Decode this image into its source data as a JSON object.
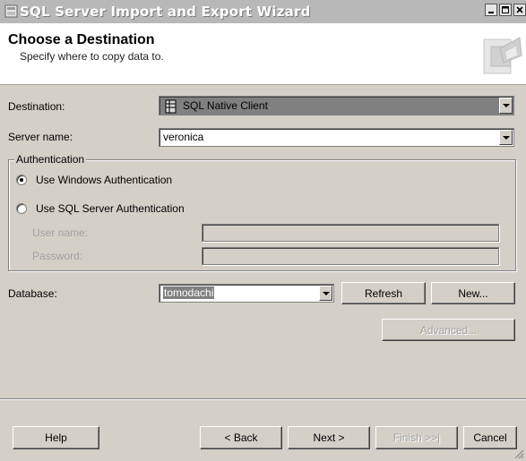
{
  "window": {
    "title": "SQL Server Import and Export Wizard"
  },
  "header": {
    "title": "Choose a Destination",
    "subtitle": "Specify where to copy data to."
  },
  "destination": {
    "label": "Destination:",
    "value": "SQL Native Client"
  },
  "server": {
    "label": "Server name:",
    "value": "veronica"
  },
  "authentication": {
    "group_label": "Authentication",
    "windows_auth_label": "Use Windows Authentication",
    "windows_auth_selected": true,
    "sql_auth_label": "Use SQL Server Authentication",
    "sql_auth_selected": false,
    "username_label": "User name:",
    "username_value": "",
    "password_label": "Password:",
    "password_value": ""
  },
  "database": {
    "label": "Database:",
    "value": "tomodachi",
    "refresh_label": "Refresh",
    "new_label": "New..."
  },
  "advanced_label": "Advanced...",
  "footer": {
    "help": "Help",
    "back": "< Back",
    "next": "Next >",
    "finish": "Finish >>|",
    "cancel": "Cancel"
  },
  "colors": {
    "dialog_bg": "#d4d0c8",
    "titlebar": "#b8b8b8",
    "header_bg": "#ffffff",
    "selected_value_bg": "#808080"
  }
}
